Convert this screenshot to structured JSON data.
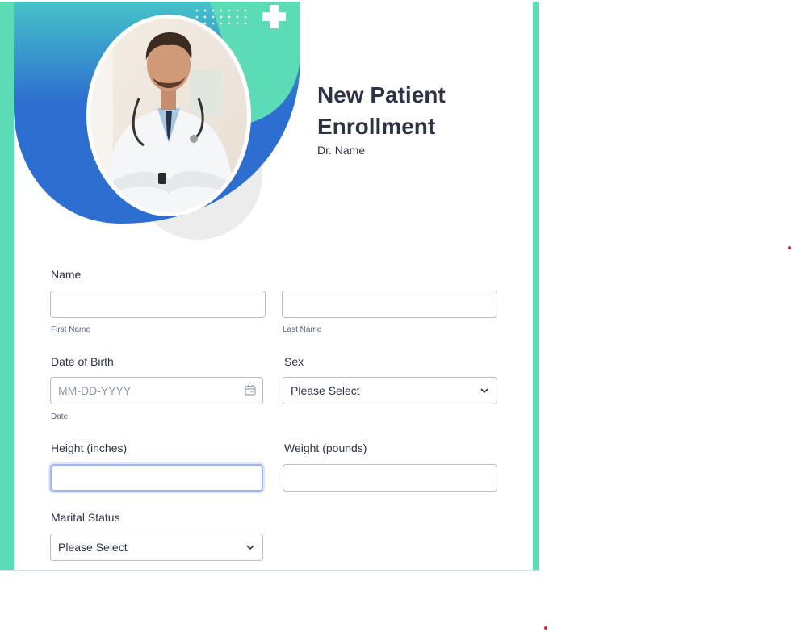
{
  "form": {
    "title": "New Patient Enrollment",
    "subtitle": "Dr. Name"
  },
  "fields": {
    "name": {
      "label": "Name",
      "first_sublabel": "First Name",
      "last_sublabel": "Last Name",
      "first_value": "",
      "last_value": ""
    },
    "dob": {
      "label": "Date of Birth",
      "placeholder": "MM-DD-YYYY",
      "sublabel": "Date",
      "icon": "calendar-icon"
    },
    "sex": {
      "label": "Sex",
      "selected": "Please Select"
    },
    "height": {
      "label": "Height (inches)",
      "value": ""
    },
    "weight": {
      "label": "Weight (pounds)",
      "value": ""
    },
    "marital": {
      "label": "Marital Status",
      "selected": "Please Select"
    }
  },
  "colors": {
    "accent": "#5cdbb7",
    "blue": "#2d6fd0",
    "text": "#2c3345",
    "focus": "#9fb6f5"
  }
}
